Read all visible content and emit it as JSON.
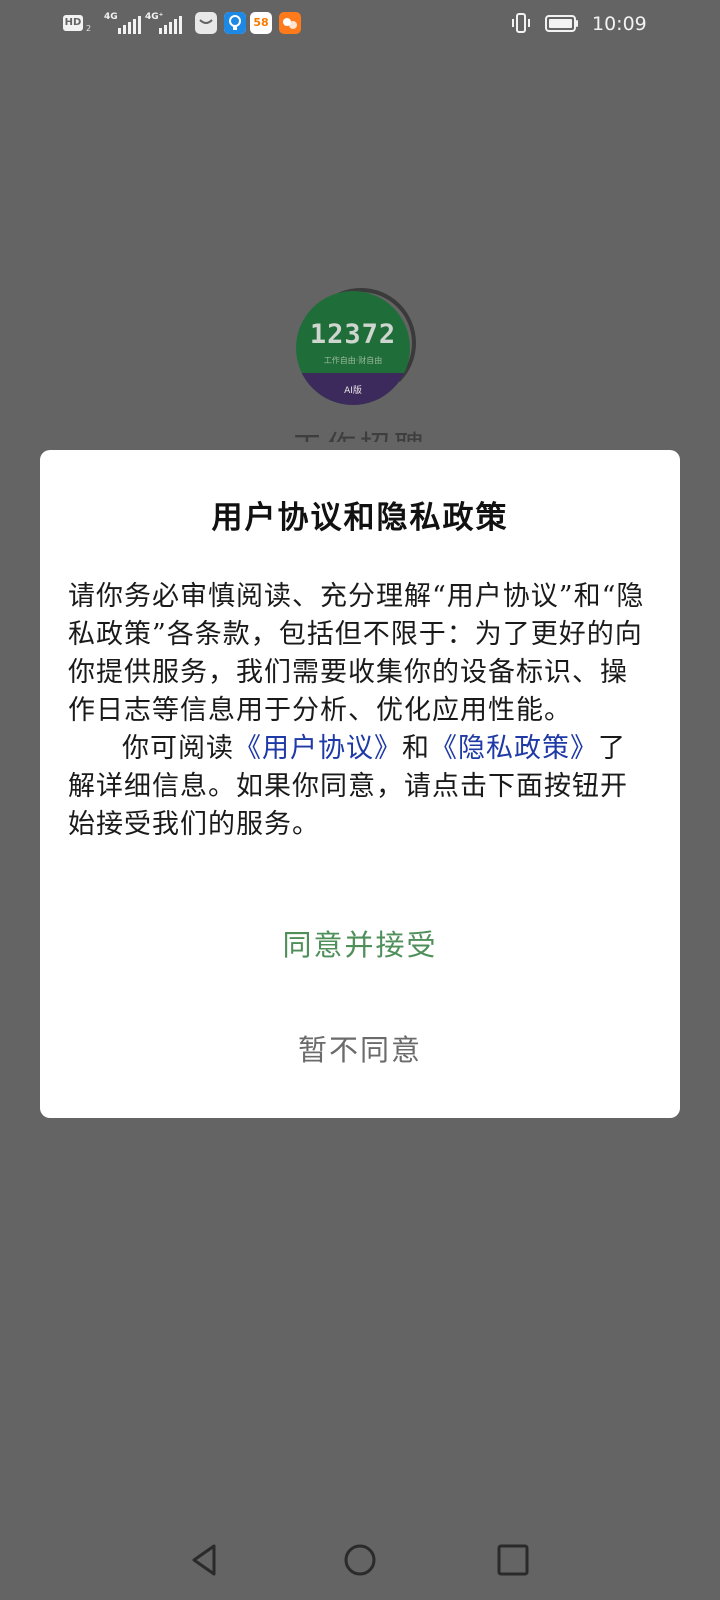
{
  "status_bar": {
    "hd_label": "HD",
    "hd_sub": "2",
    "sim1_network": "4G",
    "sim2_network": "4G⁺",
    "notification_icons": [
      "message-icon",
      "bulb-icon",
      "58-app-icon",
      "photo-app-icon"
    ],
    "app_58_label": "58",
    "time": "10:09"
  },
  "background_app": {
    "logo_number": "12372",
    "logo_slogan": "工作自由·财自由",
    "logo_tag": "AI版",
    "name_peek": "工作招聘"
  },
  "dialog": {
    "title": "用户协议和隐私政策",
    "paragraph1": "请你务必审慎阅读、充分理解“用户协议”和“隐私政策”各条款，包括但不限于：为了更好的向你提供服务，我们需要收集你的设备标识、操作日志等信息用于分析、优化应用性能。",
    "paragraph2_prefix": "你可阅读",
    "user_agreement_link": "《用户协议》",
    "paragraph2_and": "和",
    "privacy_policy_link": "《隐私政策》",
    "paragraph2_suffix": "了解详细信息。如果你同意，请点击下面按钮开始接受我们的服务。",
    "accept_label": "同意并接受",
    "decline_label": "暂不同意"
  },
  "colors": {
    "overlay": "#646464",
    "dialog_bg": "#ffffff",
    "link": "#1f3aa6",
    "accept": "#4f8f5a",
    "decline": "#6b6b6b"
  }
}
